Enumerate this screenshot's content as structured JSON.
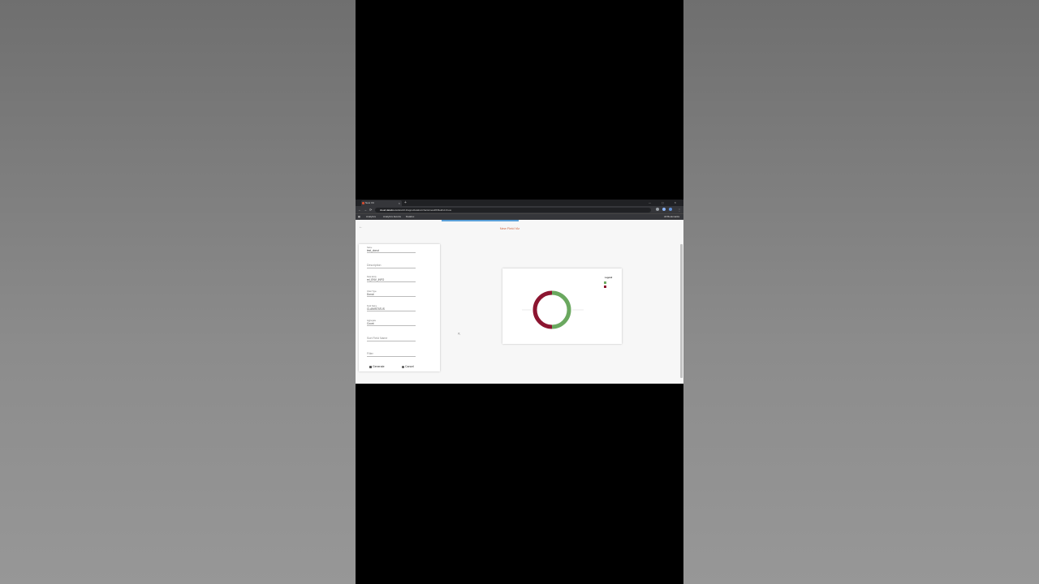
{
  "browser": {
    "tab_title": "New Viz",
    "tab_close": "×",
    "new_tab": "+",
    "window_controls": "— ▢ ✕",
    "nav": {
      "back": "←",
      "forward": "→",
      "reload": "⟳"
    },
    "url_host": "cloud.datafox.com",
    "url_path": "/anl/13/apps/datafox/charts/new#/#/field/viz/new"
  },
  "bookmarks": [
    {
      "label": "Analytics"
    },
    {
      "label": "Analytics Events"
    },
    {
      "label": "Datafox"
    }
  ],
  "bookmarks_right": "All Bookmarks",
  "app": {
    "back_icon": "←",
    "title": "New Field Viz"
  },
  "form": {
    "name_label": "Name",
    "name_value": "test_donut",
    "description_placeholder": "Description",
    "data_entity_label": "Data Entity",
    "data_entity_value": "rel_ENV_INFO",
    "chart_type_label": "Chart Type",
    "chart_type_value": "Donut",
    "field_name_label": "Field Name",
    "field_name_value": "CLAIMSTATUS",
    "aggregate_label": "Aggregate",
    "aggregate_value": "Count",
    "sort_placeholder": "Sort Field Name",
    "filter_placeholder": "Filter",
    "generate_label": "Generate",
    "cancel_label": "Cancel"
  },
  "chart_data": {
    "type": "pie",
    "title": "",
    "legend_title": "Legend",
    "legend_position": "top-right",
    "donut": true,
    "series": [
      {
        "label": "",
        "value": 50,
        "color": "#6aa85f"
      },
      {
        "label": "",
        "value": 50,
        "color": "#8c1530"
      }
    ]
  },
  "colors": {
    "accent": "#d0653f",
    "progress": "#5aa0d8"
  }
}
